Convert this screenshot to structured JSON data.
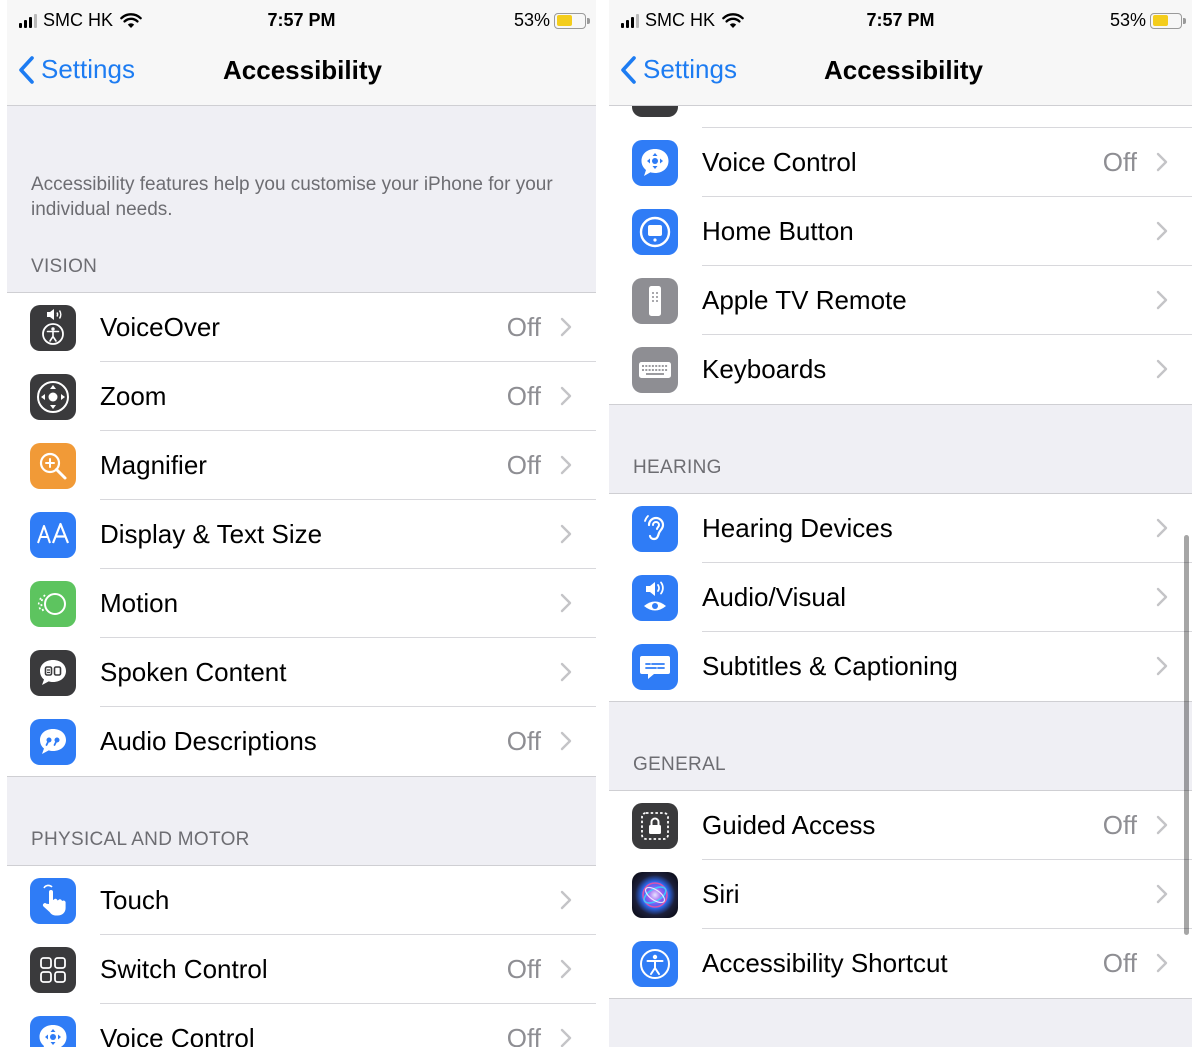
{
  "colors": {
    "accent": "#1d7cf2",
    "secondary_text": "#8e8e93",
    "group_background": "#efeff4",
    "battery_fill": "#f4cd1c"
  },
  "left": {
    "status": {
      "carrier": "SMC HK",
      "time": "7:57 PM",
      "battery": "53%"
    },
    "nav": {
      "back": "Settings",
      "title": "Accessibility"
    },
    "intro": "Accessibility features help you customise your iPhone for your individual needs.",
    "vision_header": "VISION",
    "vision": [
      {
        "label": "VoiceOver",
        "value": "Off",
        "icon": "voiceover-icon"
      },
      {
        "label": "Zoom",
        "value": "Off",
        "icon": "zoom-icon"
      },
      {
        "label": "Magnifier",
        "value": "Off",
        "icon": "magnifier-icon"
      },
      {
        "label": "Display & Text Size",
        "value": "",
        "icon": "display-text-size-icon"
      },
      {
        "label": "Motion",
        "value": "",
        "icon": "motion-icon"
      },
      {
        "label": "Spoken Content",
        "value": "",
        "icon": "spoken-content-icon"
      },
      {
        "label": "Audio Descriptions",
        "value": "Off",
        "icon": "audio-descriptions-icon"
      }
    ],
    "motor_header": "PHYSICAL AND MOTOR",
    "motor": [
      {
        "label": "Touch",
        "value": "",
        "icon": "touch-icon"
      },
      {
        "label": "Switch Control",
        "value": "Off",
        "icon": "switch-control-icon"
      },
      {
        "label": "Voice Control",
        "value": "Off",
        "icon": "voice-control-icon"
      }
    ]
  },
  "right": {
    "status": {
      "carrier": "SMC HK",
      "time": "7:57 PM",
      "battery": "53%"
    },
    "nav": {
      "back": "Settings",
      "title": "Accessibility"
    },
    "motor_tail": [
      {
        "label": "Voice Control",
        "value": "Off",
        "icon": "voice-control-icon"
      },
      {
        "label": "Home Button",
        "value": "",
        "icon": "home-button-icon"
      },
      {
        "label": "Apple TV Remote",
        "value": "",
        "icon": "apple-tv-remote-icon"
      },
      {
        "label": "Keyboards",
        "value": "",
        "icon": "keyboard-icon"
      }
    ],
    "hearing_header": "HEARING",
    "hearing": [
      {
        "label": "Hearing Devices",
        "value": "",
        "icon": "ear-icon"
      },
      {
        "label": "Audio/Visual",
        "value": "",
        "icon": "audio-visual-icon"
      },
      {
        "label": "Subtitles & Captioning",
        "value": "",
        "icon": "subtitles-icon"
      }
    ],
    "general_header": "GENERAL",
    "general": [
      {
        "label": "Guided Access",
        "value": "Off",
        "icon": "guided-access-icon"
      },
      {
        "label": "Siri",
        "value": "",
        "icon": "siri-icon"
      },
      {
        "label": "Accessibility Shortcut",
        "value": "Off",
        "icon": "accessibility-shortcut-icon"
      }
    ]
  }
}
